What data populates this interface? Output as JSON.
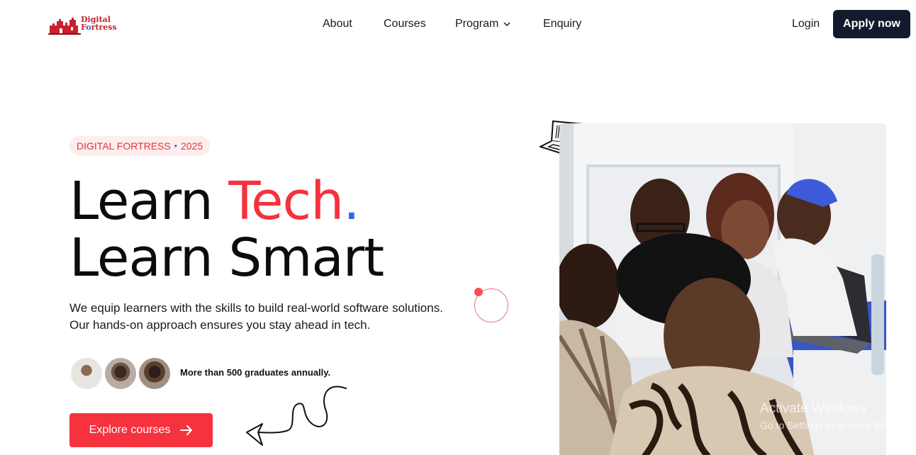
{
  "brand": {
    "name_line1": "Digital",
    "name_line2_prefix": "F",
    "name_line2_o": "o",
    "name_line2_suffix": "rtress",
    "accent": "#f5323e",
    "dark": "#131a2b",
    "blue": "#2b6be6"
  },
  "nav": {
    "items": [
      {
        "label": "About"
      },
      {
        "label": "Courses"
      },
      {
        "label": "Program",
        "icon": "chevron-down-icon"
      },
      {
        "label": "Enquiry"
      }
    ],
    "login": "Login",
    "apply": "Apply now"
  },
  "hero": {
    "badge_left": "DIGITAL FORTRESS",
    "badge_sep": "•",
    "badge_right": "2025",
    "headline_learn": "Learn ",
    "headline_tech": "Tech",
    "headline_dot": ".",
    "headline_line2": "Learn Smart",
    "description_line1": "We equip learners with the skills to build real-world software solutions.",
    "description_line2": "Our hands-on approach ensures you stay ahead in tech.",
    "graduates_text": "More than 500 graduates annually.",
    "cta": "Explore courses"
  },
  "system": {
    "watermark_title": "Activate Windows",
    "watermark_sub": "Go to Settings to activate Windows."
  }
}
